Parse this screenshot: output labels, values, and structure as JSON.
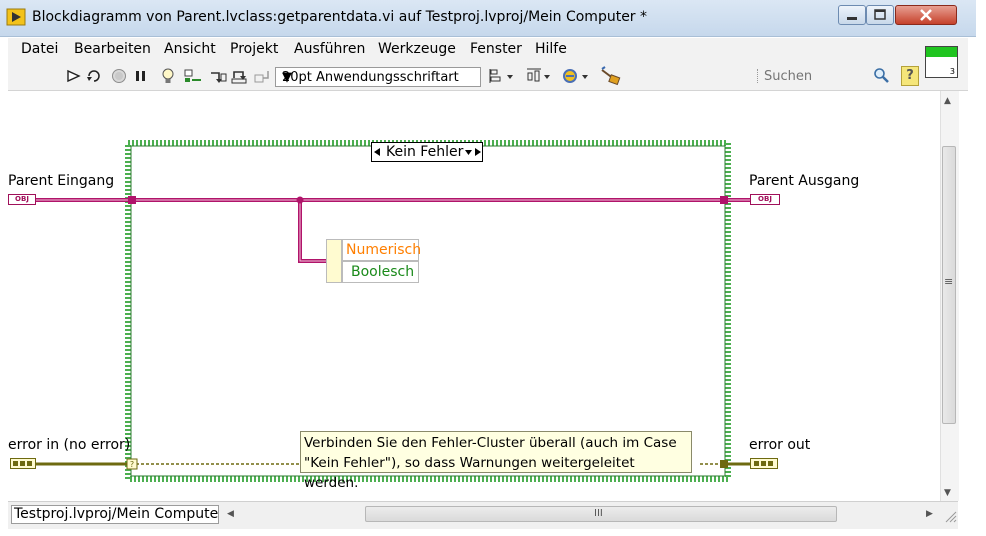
{
  "window": {
    "title": "Blockdiagramm von Parent.lvclass:getparentdata.vi auf Testproj.lvproj/Mein Computer *"
  },
  "menu": [
    "Datei",
    "Bearbeiten",
    "Ansicht",
    "Projekt",
    "Ausführen",
    "Werkzeuge",
    "Fenster",
    "Hilfe"
  ],
  "toolbar": {
    "font": "20pt Anwendungsschriftart",
    "search_placeholder": "Suchen",
    "help_label": "?",
    "run_indicator_number": "3"
  },
  "diagram": {
    "case_selector": "Kein Fehler",
    "parent_in_label": "Parent Eingang",
    "parent_out_label": "Parent Ausgang",
    "error_in_label": "error in (no error)",
    "error_out_label": "error out",
    "obj_terminal": "OBJ",
    "unbundle_items": [
      "Numerisch",
      "Boolesch"
    ],
    "comment": "Verbinden Sie den Fehler-Cluster überall (auch im Case \"Kein Fehler\"), so dass Warnungen weitergeleitet werden.",
    "tunnel_unwired": "?"
  },
  "status": {
    "context_path": "Testproj.lvproj/Mein Computer",
    "hscroll_label": "III",
    "vscroll_label": "≡"
  },
  "colors": {
    "class_wire": "#b0146a",
    "error_wire": "#6e6a10",
    "case_border": "#4caf50",
    "green_indicator": "#1fc41f"
  }
}
